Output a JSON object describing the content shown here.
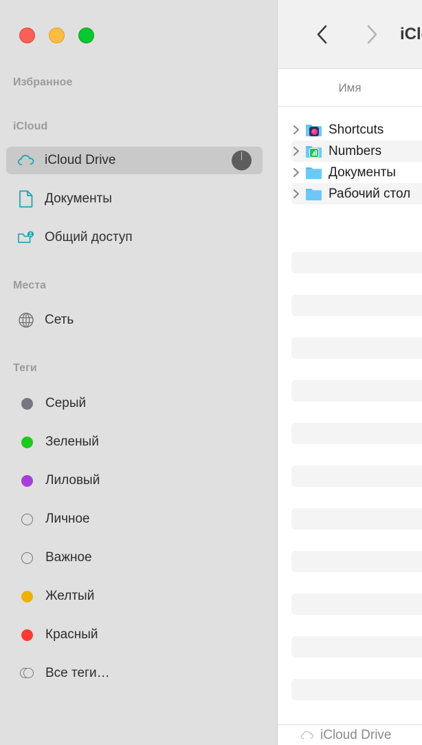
{
  "window": {
    "traffic_lights": [
      {
        "name": "close",
        "color": "#fb5f57"
      },
      {
        "name": "minimize",
        "color": "#fcbc40"
      },
      {
        "name": "maximize",
        "color": "#05c833"
      }
    ]
  },
  "sidebar": {
    "sections": [
      {
        "key": "favorites",
        "title": "Избранное"
      },
      {
        "key": "icloud",
        "title": "iCloud"
      },
      {
        "key": "places",
        "title": "Места"
      },
      {
        "key": "tags",
        "title": "Теги"
      }
    ],
    "icloud_items": [
      {
        "label": "iCloud Drive",
        "icon": "cloud-icon",
        "selected": true,
        "progress_badge": true
      },
      {
        "label": "Документы",
        "icon": "document-icon",
        "selected": false,
        "progress_badge": false
      },
      {
        "label": "Общий доступ",
        "icon": "shared-folder-icon",
        "selected": false,
        "progress_badge": false
      }
    ],
    "places_items": [
      {
        "label": "Сеть",
        "icon": "globe-icon"
      }
    ],
    "tags": [
      {
        "label": "Серый",
        "color": "#767680",
        "hollow": false
      },
      {
        "label": "Зеленый",
        "color": "#1ec81e",
        "hollow": false
      },
      {
        "label": "Лиловый",
        "color": "#a63fd9",
        "hollow": false
      },
      {
        "label": "Личное",
        "color": "",
        "hollow": true
      },
      {
        "label": "Важное",
        "color": "",
        "hollow": true
      },
      {
        "label": "Желтый",
        "color": "#edb100",
        "hollow": false
      },
      {
        "label": "Красный",
        "color": "#fb3b30",
        "hollow": false
      }
    ],
    "all_tags": {
      "label": "Все теги…",
      "icon": "all-tags-icon"
    },
    "accent_icon_color": "#1b9fb5"
  },
  "toolbar": {
    "back_label": "‹",
    "forward_label": "›",
    "title": "iCloud Drive"
  },
  "columns": {
    "name_header": "Имя"
  },
  "files": [
    {
      "name": "Shortcuts",
      "icon": "folder-icon",
      "badge": "shortcuts-badge",
      "expandable": true
    },
    {
      "name": "Numbers",
      "icon": "folder-icon",
      "badge": "numbers-badge",
      "expandable": true
    },
    {
      "name": "Документы",
      "icon": "folder-icon",
      "badge": "",
      "expandable": true
    },
    {
      "name": "Рабочий стол",
      "icon": "folder-icon",
      "badge": "",
      "expandable": true
    }
  ],
  "path_bar": {
    "icon": "cloud-icon",
    "label": "iCloud Drive"
  }
}
